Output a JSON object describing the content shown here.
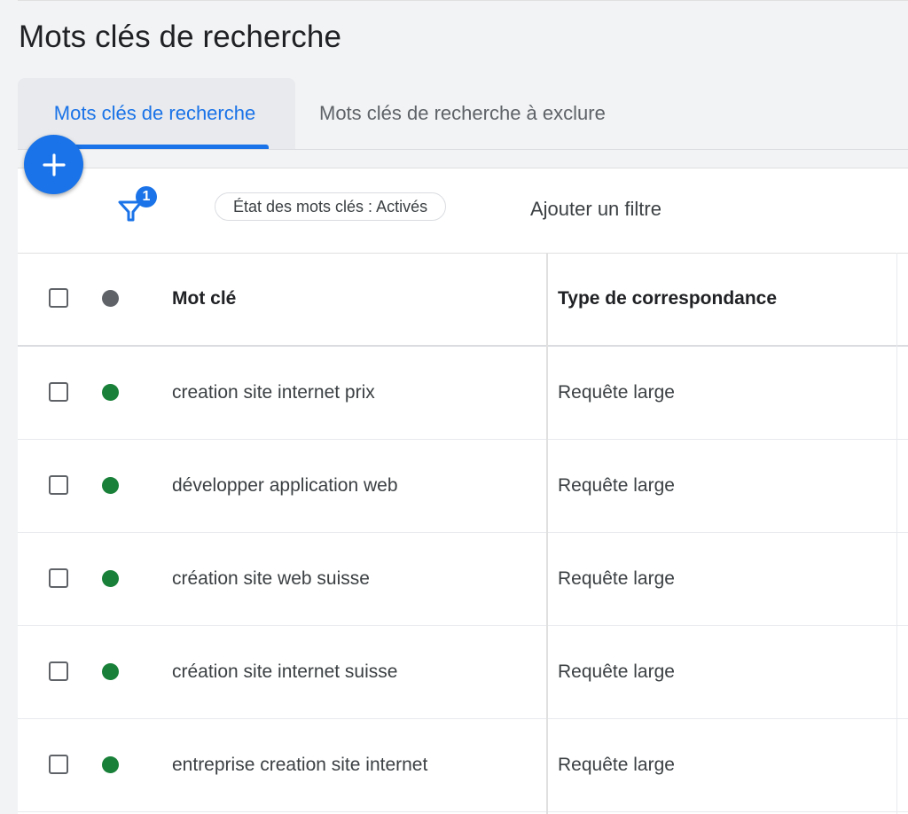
{
  "page": {
    "title": "Mots clés de recherche"
  },
  "tabs": [
    {
      "label": "Mots clés de recherche",
      "active": true
    },
    {
      "label": "Mots clés de recherche à exclure",
      "active": false
    }
  ],
  "toolbar": {
    "add_icon": "plus-icon",
    "filter_icon": "filter-icon",
    "filter_count": "1",
    "filter_chip": "État des mots clés : Activés",
    "add_filter_label": "Ajouter un filtre"
  },
  "table": {
    "columns": {
      "keyword": "Mot clé",
      "match_type": "Type de correspondance"
    },
    "rows": [
      {
        "keyword": "creation site internet prix",
        "match_type": "Requête large",
        "status": "enabled"
      },
      {
        "keyword": "développer application web",
        "match_type": "Requête large",
        "status": "enabled"
      },
      {
        "keyword": "création site web suisse",
        "match_type": "Requête large",
        "status": "enabled"
      },
      {
        "keyword": "création site internet suisse",
        "match_type": "Requête large",
        "status": "enabled"
      },
      {
        "keyword": "entreprise creation site internet",
        "match_type": "Requête large",
        "status": "enabled"
      }
    ]
  },
  "colors": {
    "accent": "#1a73e8",
    "status_enabled": "#188038",
    "status_header": "#5f6368"
  }
}
